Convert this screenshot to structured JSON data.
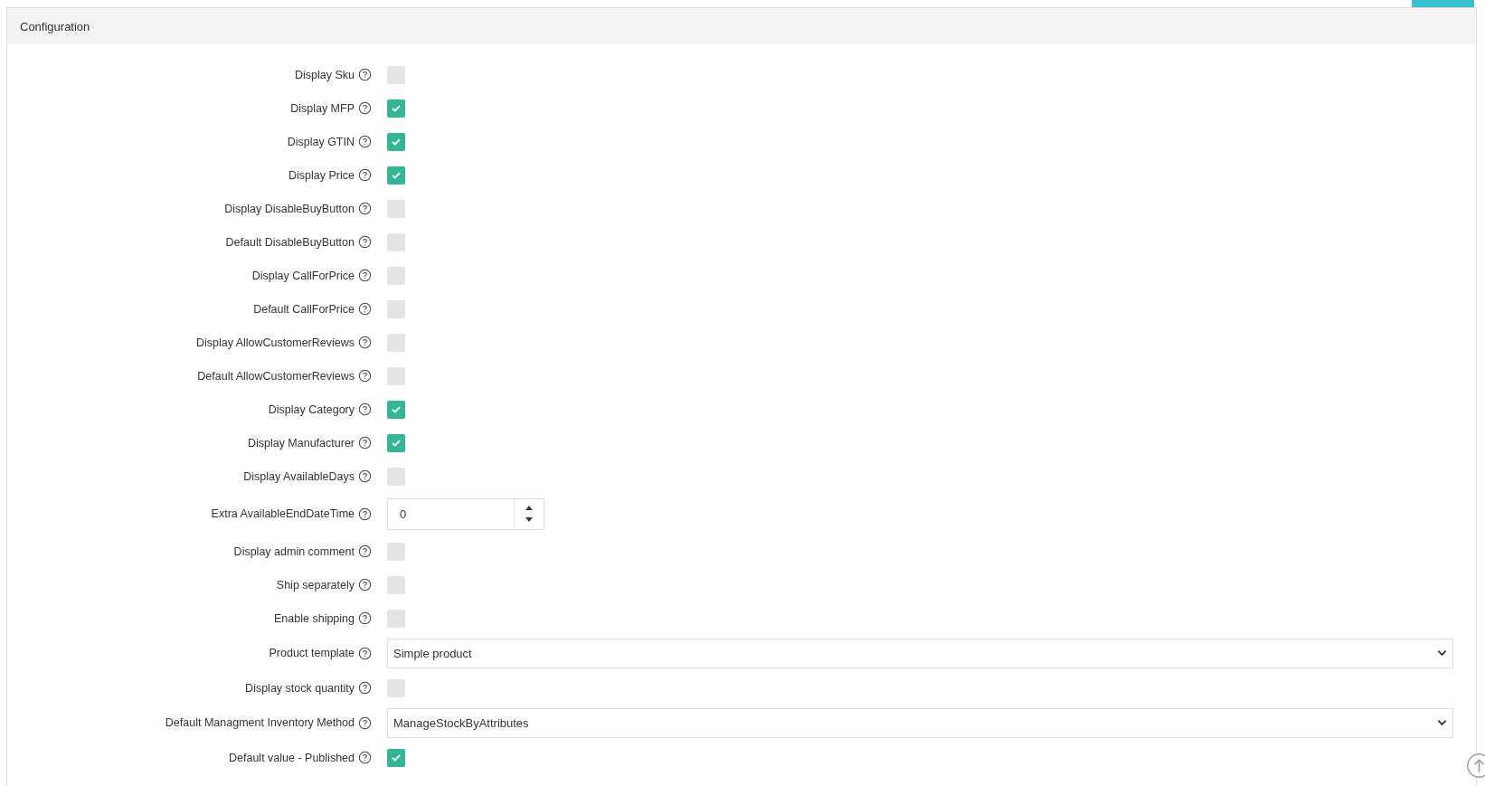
{
  "panel": {
    "title": "Configuration"
  },
  "rows": [
    {
      "kind": "checkbox",
      "label": "Display Sku",
      "checked": false
    },
    {
      "kind": "checkbox",
      "label": "Display MFP",
      "checked": true
    },
    {
      "kind": "checkbox",
      "label": "Display GTIN",
      "checked": true
    },
    {
      "kind": "checkbox",
      "label": "Display Price",
      "checked": true
    },
    {
      "kind": "checkbox",
      "label": "Display DisableBuyButton",
      "checked": false
    },
    {
      "kind": "checkbox",
      "label": "Default DisableBuyButton",
      "checked": false
    },
    {
      "kind": "checkbox",
      "label": "Display CallForPrice",
      "checked": false
    },
    {
      "kind": "checkbox",
      "label": "Default CallForPrice",
      "checked": false
    },
    {
      "kind": "checkbox",
      "label": "Display AllowCustomerReviews",
      "checked": false
    },
    {
      "kind": "checkbox",
      "label": "Default AllowCustomerReviews",
      "checked": false
    },
    {
      "kind": "checkbox",
      "label": "Display Category",
      "checked": true
    },
    {
      "kind": "checkbox",
      "label": "Display Manufacturer",
      "checked": true
    },
    {
      "kind": "checkbox",
      "label": "Display AvailableDays",
      "checked": false
    },
    {
      "kind": "number",
      "label": "Extra AvailableEndDateTime",
      "value": "0"
    },
    {
      "kind": "checkbox",
      "label": "Display admin comment",
      "checked": false
    },
    {
      "kind": "checkbox",
      "label": "Ship separately",
      "checked": false
    },
    {
      "kind": "checkbox",
      "label": "Enable shipping",
      "checked": false
    },
    {
      "kind": "select",
      "label": "Product template",
      "value": "Simple product"
    },
    {
      "kind": "checkbox",
      "label": "Display stock quantity",
      "checked": false
    },
    {
      "kind": "select",
      "label": "Default Managment Inventory Method",
      "value": "ManageStockByAttributes"
    },
    {
      "kind": "checkbox",
      "label": "Default value - Published",
      "checked": true
    }
  ]
}
